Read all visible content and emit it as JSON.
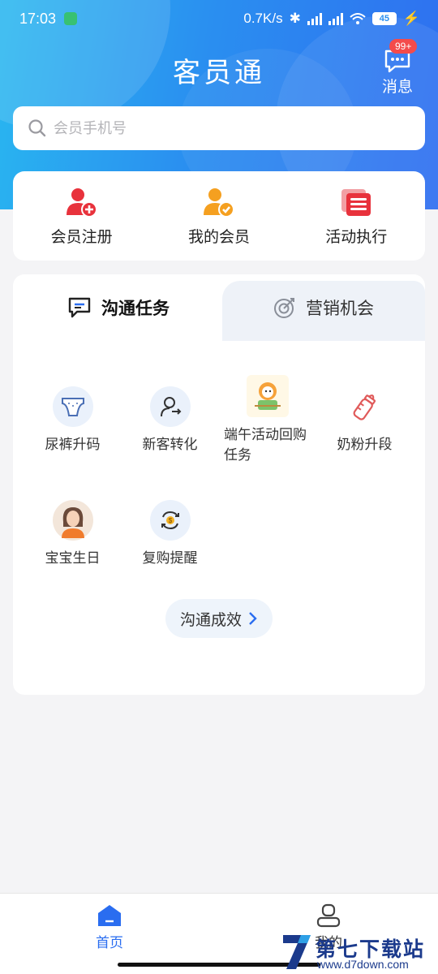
{
  "status_bar": {
    "time": "17:03",
    "net_speed": "0.7K/s",
    "battery": "45"
  },
  "header": {
    "title": "客员通",
    "messages_label": "消息",
    "messages_badge": "99+"
  },
  "search": {
    "placeholder": "会员手机号",
    "icon": "search-icon"
  },
  "quick_actions": [
    {
      "label": "会员注册",
      "icon": "user-add-icon",
      "color": "#e8323c"
    },
    {
      "label": "我的会员",
      "icon": "user-check-icon",
      "color": "#f5a020"
    },
    {
      "label": "活动执行",
      "icon": "activity-icon",
      "color": "#e8323c"
    }
  ],
  "tabs": {
    "active": "沟通任务",
    "inactive": "营销机会"
  },
  "tasks": [
    {
      "label": "尿裤升码",
      "icon": "diaper-icon"
    },
    {
      "label": "新客转化",
      "icon": "user-convert-icon"
    },
    {
      "label": "端午活动回购任务",
      "icon": "dragon-boat-icon"
    },
    {
      "label": "奶粉升段",
      "icon": "milk-bottle-icon"
    },
    {
      "label": "宝宝生日",
      "icon": "mother-avatar-icon"
    },
    {
      "label": "复购提醒",
      "icon": "repurchase-icon"
    }
  ],
  "effect_button": "沟通成效",
  "bottom_nav": {
    "home": "首页",
    "mine": "我的"
  },
  "watermark": {
    "text": "第七下载站",
    "sub": "www.d7down.com"
  },
  "colors": {
    "primary": "#2a6df0",
    "hero_start": "#29b7f0",
    "hero_end": "#2f6ef0",
    "badge": "#f44b4b"
  }
}
